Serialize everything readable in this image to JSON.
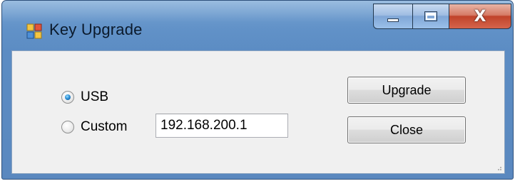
{
  "window": {
    "title": "Key Upgrade",
    "app_icon": "windows-form-icon"
  },
  "caption_buttons": {
    "minimize_icon": "minimize-icon",
    "maximize_icon": "maximize-icon",
    "close_label": "X"
  },
  "connection": {
    "options": [
      {
        "label": "USB",
        "selected": true
      },
      {
        "label": "Custom",
        "selected": false
      }
    ],
    "custom_address": "192.168.200.1"
  },
  "actions": {
    "upgrade_label": "Upgrade",
    "close_label": "Close"
  },
  "colors": {
    "title_bar": "#5c8dc4",
    "close_button": "#c0432a",
    "client_bg": "#f0f0f0"
  }
}
